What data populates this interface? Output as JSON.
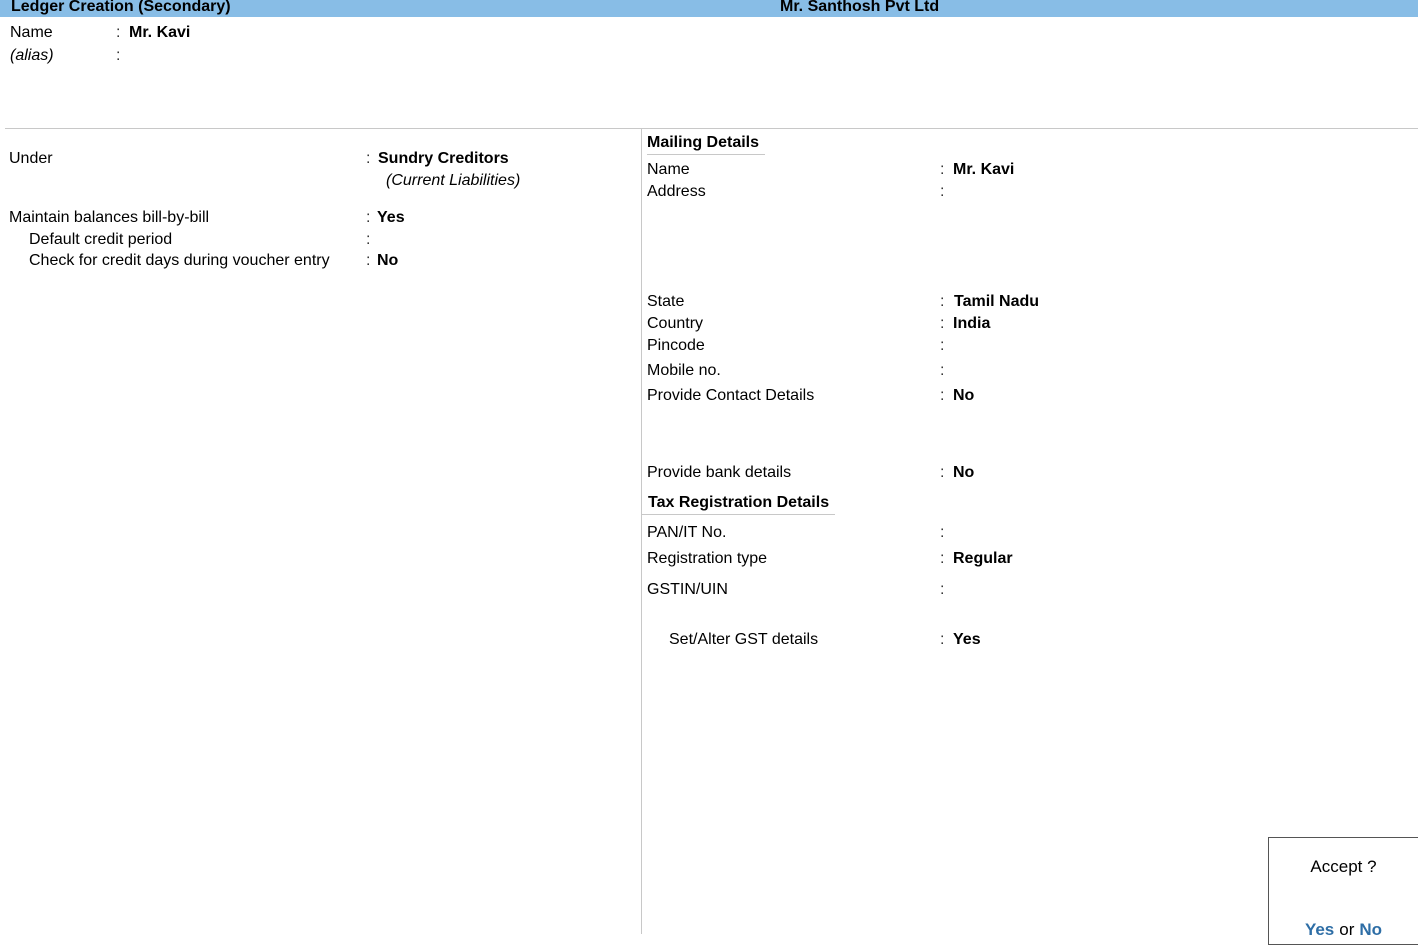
{
  "titlebar": {
    "screen_title": "Ledger Creation (Secondary)",
    "company": "Mr. Santhosh Pvt Ltd"
  },
  "header": {
    "name_label": "Name",
    "name_value": "Mr. Kavi",
    "alias_label": "(alias)",
    "alias_value": ""
  },
  "left": {
    "under_label": "Under",
    "under_value": "Sundry Creditors",
    "under_parent": "(Current Liabilities)",
    "bill_by_bill_label": "Maintain balances bill-by-bill",
    "bill_by_bill_value": "Yes",
    "credit_period_label": "Default credit period",
    "credit_period_value": "",
    "credit_days_label": "Check for credit days during voucher entry",
    "credit_days_value": "No"
  },
  "mailing": {
    "heading": "Mailing Details",
    "name_label": "Name",
    "name_value": "Mr. Kavi",
    "address_label": "Address",
    "address_value": "",
    "state_label": "State",
    "state_value": "Tamil Nadu",
    "country_label": "Country",
    "country_value": "India",
    "pincode_label": "Pincode",
    "pincode_value": "",
    "mobile_label": "Mobile no.",
    "mobile_value": "",
    "contact_label": "Provide Contact Details",
    "contact_value": "No",
    "bank_label": "Provide bank details",
    "bank_value": "No"
  },
  "tax": {
    "heading": "Tax Registration Details",
    "pan_label": "PAN/IT No.",
    "pan_value": "",
    "regtype_label": "Registration type",
    "regtype_value": "Regular",
    "gstin_label": "GSTIN/UIN",
    "gstin_value": "",
    "gst_details_label": "Set/Alter GST details",
    "gst_details_value": "Yes"
  },
  "accept_dialog": {
    "question": "Accept ?",
    "yes": "Yes",
    "or": "or",
    "no": "No"
  },
  "colon": ":"
}
